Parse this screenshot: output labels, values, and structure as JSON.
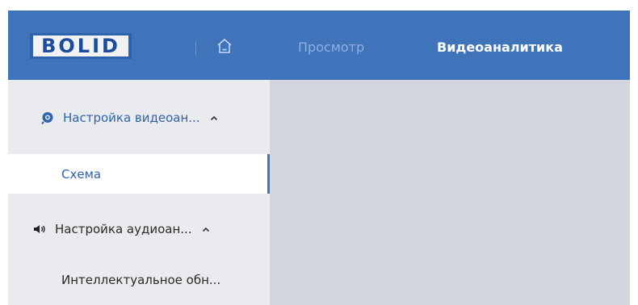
{
  "header": {
    "logo_text": "BOLID",
    "home_icon": "home-icon",
    "nav": [
      {
        "label": "Просмотр",
        "active": false
      },
      {
        "label": "Видеоаналитика",
        "active": true
      }
    ],
    "background_color": "#3f73ba"
  },
  "sidebar": {
    "items": [
      {
        "label": "Настройка видеоан...",
        "icon": "video-analytics-icon",
        "expanded": true,
        "caret": "chevron-up-icon"
      },
      {
        "label": "Схема",
        "selected": true
      },
      {
        "label": "Настройка аудиоан...",
        "icon": "speaker-icon",
        "expanded": true,
        "caret": "chevron-up-icon"
      },
      {
        "label": "Интеллектуальное обн..."
      }
    ],
    "accent_color": "#2e63b0"
  }
}
